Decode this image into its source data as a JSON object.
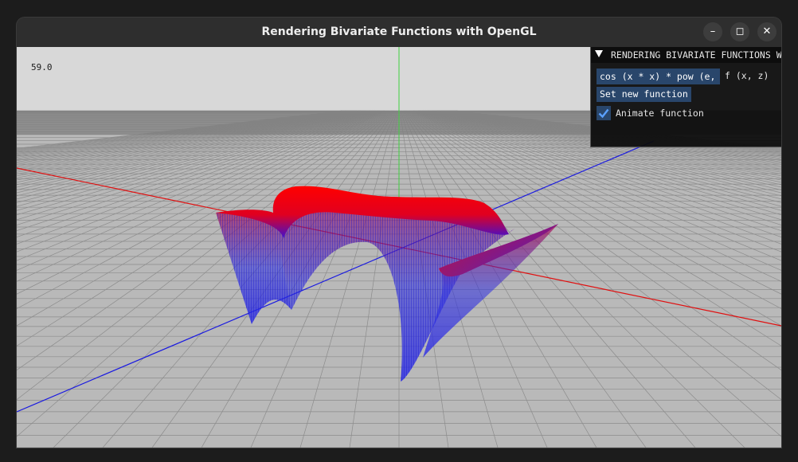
{
  "window": {
    "title": "Rendering Bivariate Functions with OpenGL",
    "minimize_icon": "minimize-icon",
    "maximize_icon": "maximize-icon",
    "close_icon": "close-icon"
  },
  "viewport": {
    "fps": "59.0",
    "colors": {
      "sky": "#d8d8d8",
      "ground": "#b9b9b9",
      "x_axis": "#e01010",
      "y_axis": "#40d040",
      "z_axis": "#1a1ae0",
      "surface_high": "#ff0000",
      "surface_low": "#2a2ae6"
    }
  },
  "panel": {
    "title": "RENDERING BIVARIATE FUNCTIONS WITH OPENGL",
    "collapse_icon": "collapse-triangle-icon",
    "function_value": "cos (x * x) * pow (e, -z * z)",
    "function_label": "f (x, z)",
    "set_button": "Set new function",
    "animate_label": "Animate function",
    "animate_checked": true,
    "accent": "#29466b"
  }
}
